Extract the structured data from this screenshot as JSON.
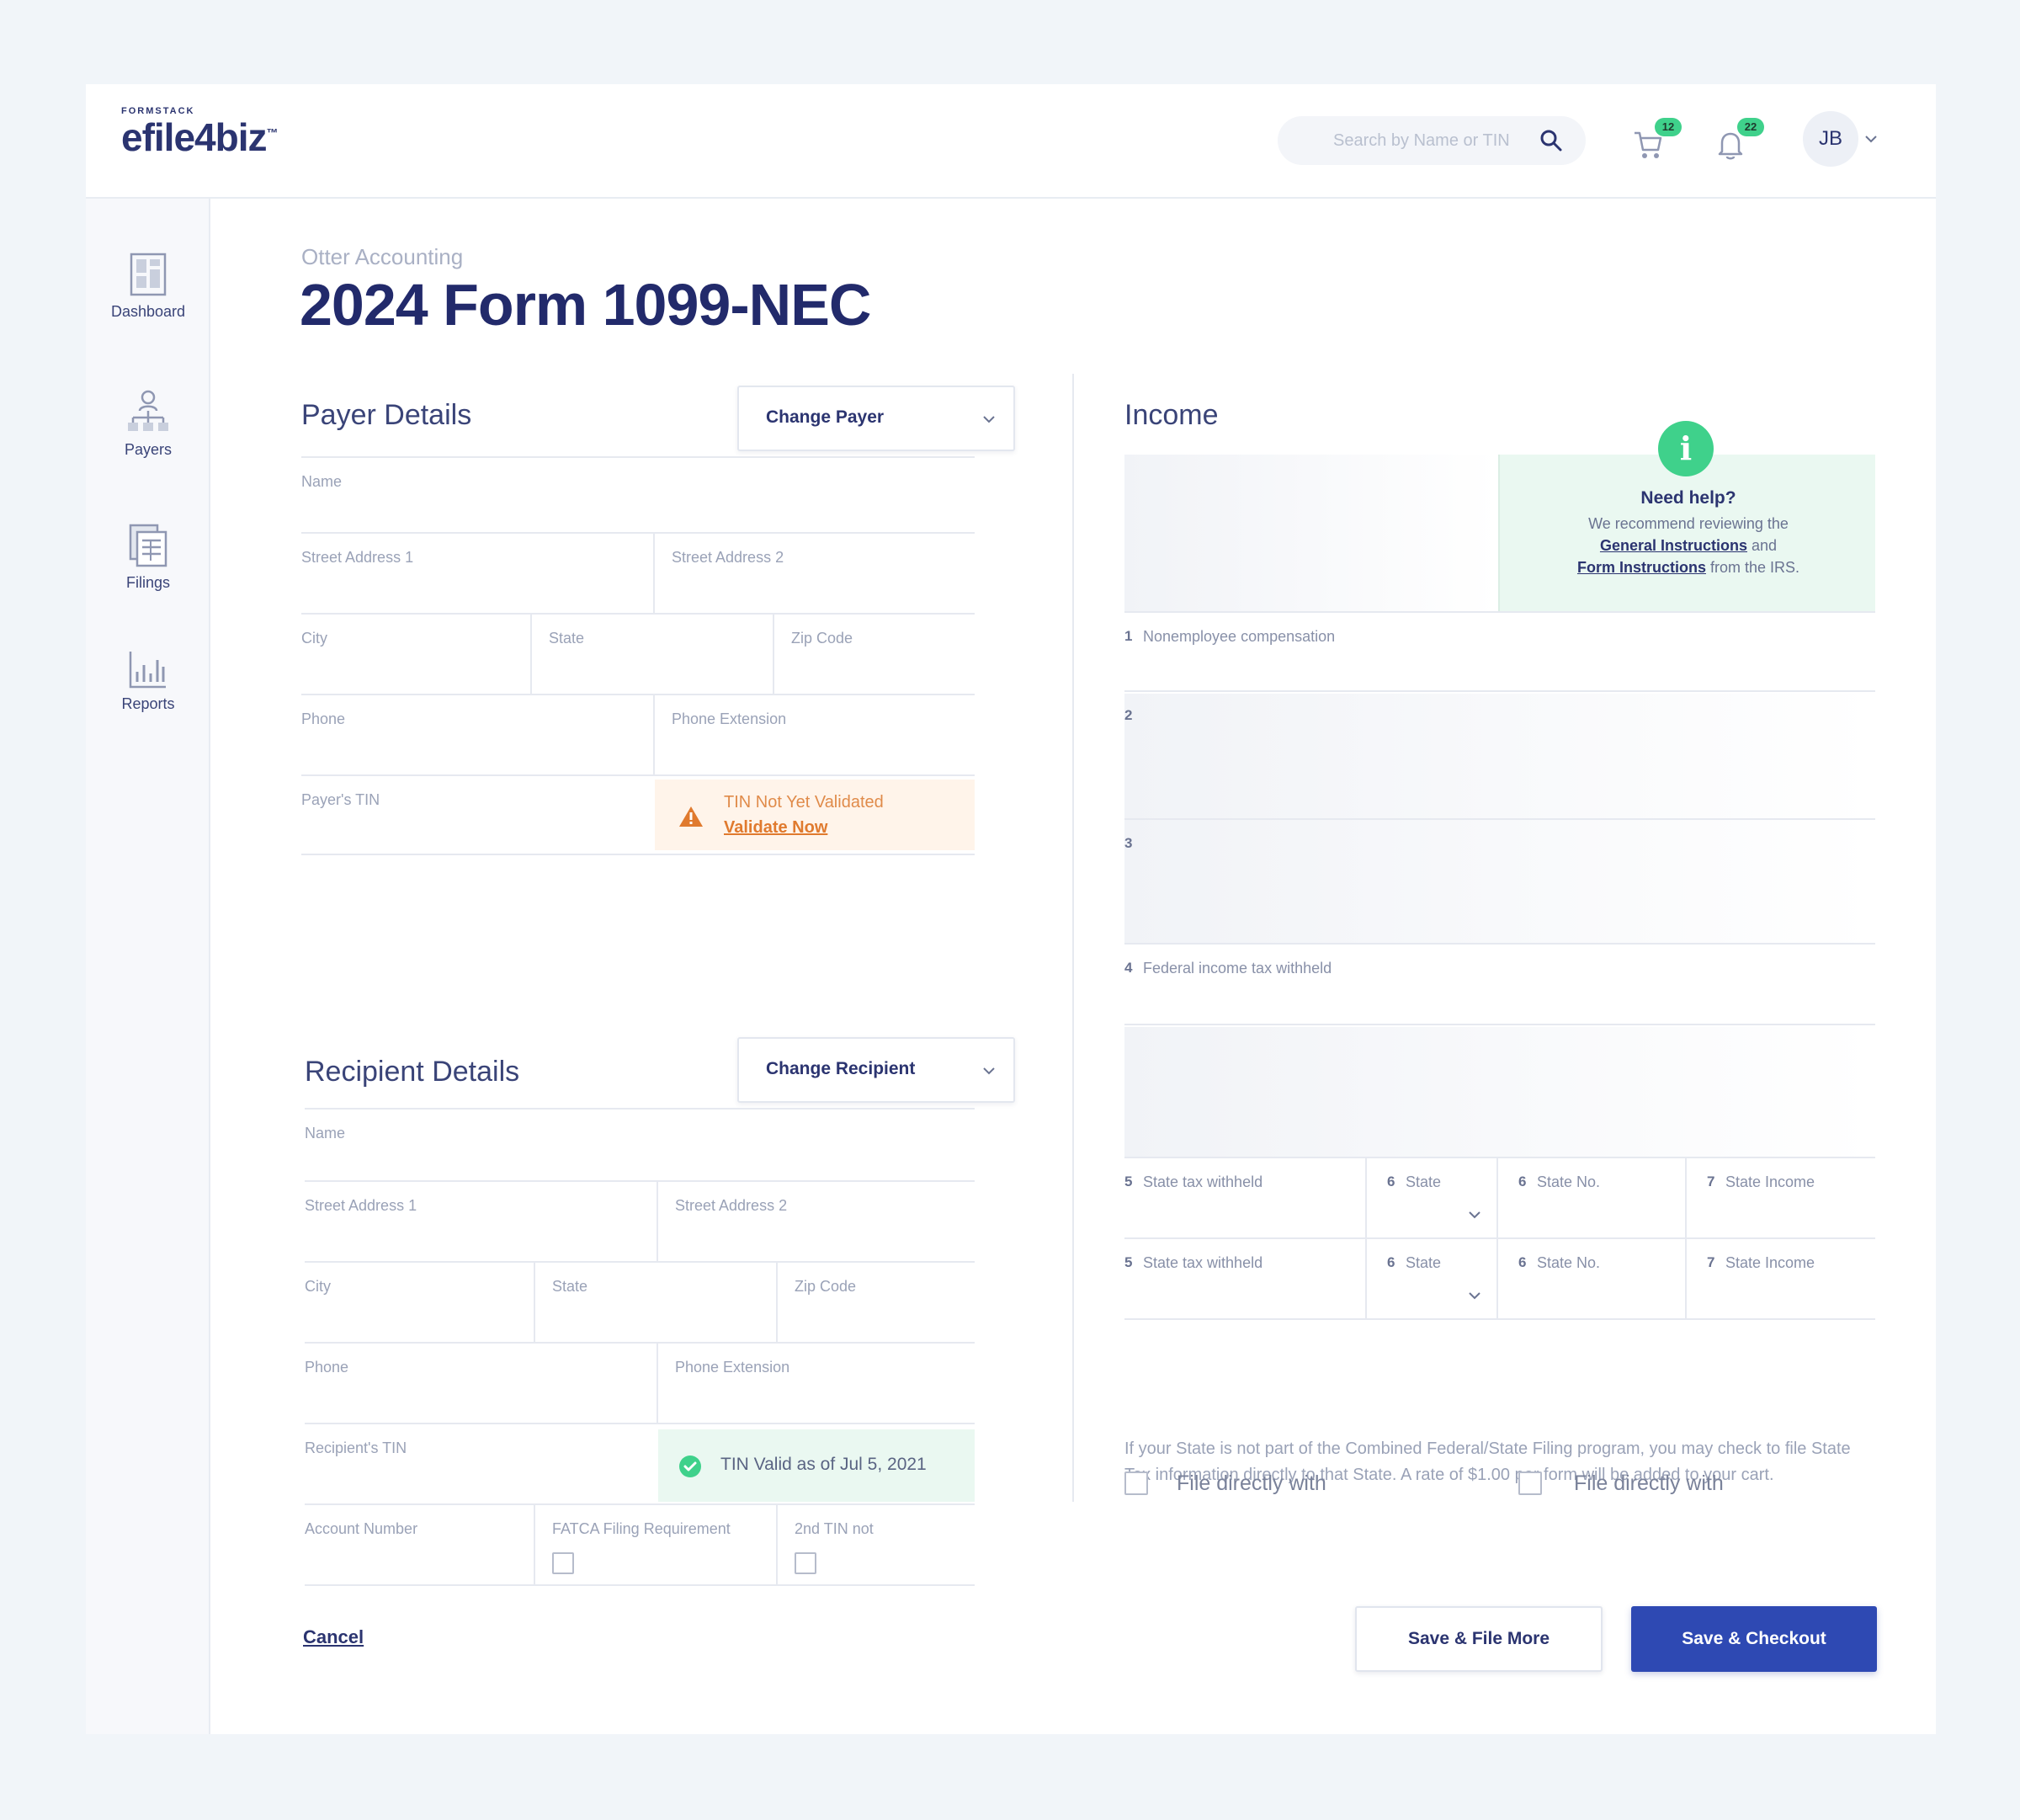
{
  "app": {
    "brand_top": "FORMSTACK",
    "brand_main": "efile4biz",
    "brand_tm": "™"
  },
  "header": {
    "search_placeholder": "Search by Name or TIN",
    "cart_count": "12",
    "notif_count": "22",
    "avatar_initials": "JB",
    "icons": [
      "search-icon",
      "cart-icon",
      "bell-icon",
      "chevron-down-icon"
    ]
  },
  "sidebar": {
    "items": [
      {
        "label": "Dashboard",
        "icon": "dashboard-icon"
      },
      {
        "label": "Payers",
        "icon": "org-chart-icon"
      },
      {
        "label": "Filings",
        "icon": "filings-icon"
      },
      {
        "label": "Reports",
        "icon": "bar-chart-icon"
      }
    ]
  },
  "page": {
    "org": "Otter Accounting",
    "title": "2024 Form 1099-NEC"
  },
  "payer": {
    "title": "Payer Details",
    "change_label": "Change Payer",
    "fields": {
      "name": "Name",
      "street1": "Street Address 1",
      "street2": "Street Address 2",
      "city": "City",
      "state": "State",
      "zip": "Zip Code",
      "phone": "Phone",
      "phone_ext": "Phone Extension",
      "tin": "Payer's TIN"
    },
    "tin_status": {
      "message": "TIN Not Yet Validated",
      "action": "Validate Now",
      "color": "#e07a2e"
    }
  },
  "recipient": {
    "title": "Recipient Details",
    "change_label": "Change Recipient",
    "fields": {
      "name": "Name",
      "street1": "Street Address 1",
      "street2": "Street Address 2",
      "city": "City",
      "state": "State",
      "zip": "Zip Code",
      "phone": "Phone",
      "phone_ext": "Phone Extension",
      "tin": "Recipient's TIN",
      "account": "Account Number",
      "fatca": "FATCA Filing Requirement",
      "second_tin": "2nd TIN not"
    },
    "tin_status": {
      "message": "TIN Valid as of Jul 5, 2021",
      "color": "#3fd18b"
    }
  },
  "income": {
    "title": "Income",
    "help": {
      "title": "Need help?",
      "line1": "We recommend reviewing the",
      "link1": "General Instructions",
      "and": "and",
      "link2": "Form Instructions",
      "suffix": "from the IRS."
    },
    "boxes": [
      {
        "num": "1",
        "label": "Nonemployee compensation"
      },
      {
        "num": "2",
        "label": ""
      },
      {
        "num": "3",
        "label": ""
      },
      {
        "num": "4",
        "label": "Federal income tax withheld"
      }
    ],
    "state_rows": [
      {
        "b5": "5",
        "l5": "State tax withheld",
        "b6a": "6",
        "l6a": "State",
        "b6b": "6",
        "l6b": "State No.",
        "b7": "7",
        "l7": "State Income"
      },
      {
        "b5": "5",
        "l5": "State tax withheld",
        "b6a": "6",
        "l6a": "State",
        "b6b": "6",
        "l6b": "State No.",
        "b7": "7",
        "l7": "State Income"
      }
    ],
    "note": "If your State is not part of the Combined Federal/State Filing program, you may check to file State Tax information directly to that State. A rate of $1.00 per form will be added to your cart.",
    "file_direct_1": "File directly with",
    "file_direct_2": "File directly with"
  },
  "footer": {
    "cancel": "Cancel",
    "save_more": "Save & File More",
    "save_checkout": "Save & Checkout",
    "primary_color": "#2e49b3"
  }
}
